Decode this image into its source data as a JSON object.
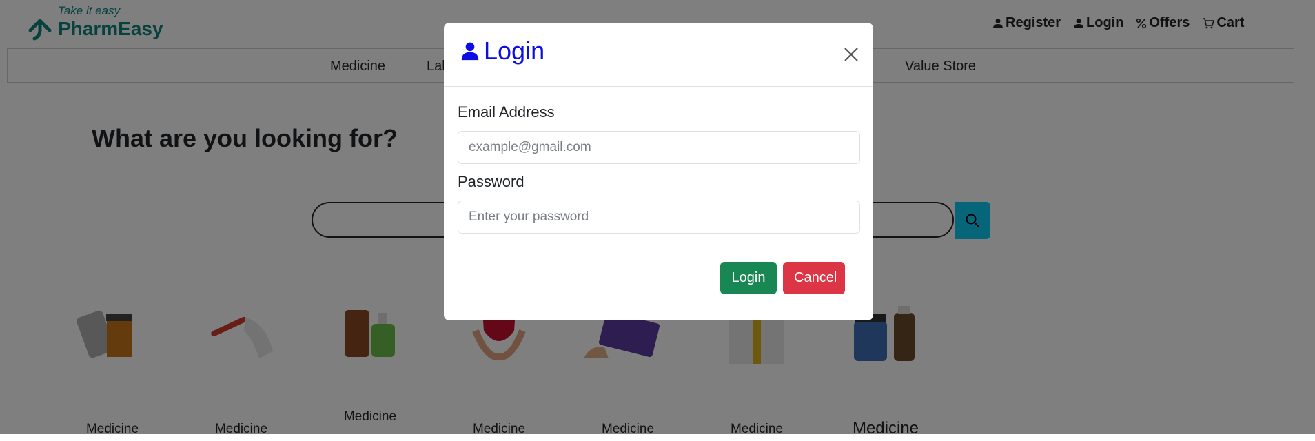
{
  "brand": {
    "tagline": "Take it easy",
    "name": "PharmEasy",
    "color": "#10847e"
  },
  "top_nav": {
    "items": [
      {
        "label": "Register",
        "icon": "user-icon"
      },
      {
        "label": "Login",
        "icon": "user-icon"
      },
      {
        "label": "Offers",
        "icon": "percent-icon"
      },
      {
        "label": "Cart",
        "icon": "cart-icon"
      }
    ]
  },
  "sub_nav": {
    "items": [
      "Medicine",
      "Lab",
      "Value Store"
    ]
  },
  "hero": {
    "title": "What are you looking for?"
  },
  "search": {
    "button_icon": "search-icon",
    "button_color": "#0dcaf0"
  },
  "categories": [
    {
      "label": "Medicine",
      "image": "pills-bottle-image"
    },
    {
      "label": "Medicine",
      "image": "blood-test-tube-image"
    },
    {
      "label": "Medicine",
      "image": "personal-care-products-image"
    },
    {
      "label": "Medicine",
      "image": "heart-in-hands-image"
    },
    {
      "label": "Medicine",
      "image": "plus-card-image"
    },
    {
      "label": "Medicine",
      "image": "gift-box-image"
    },
    {
      "label": "Medicine",
      "image": "liveasy-bottles-image"
    }
  ],
  "modal": {
    "title": "Login",
    "title_color": "#0d0de6",
    "email": {
      "label": "Email Address",
      "placeholder": "example@gmail.com",
      "value": ""
    },
    "password": {
      "label": "Password",
      "placeholder": "Enter your password",
      "value": ""
    },
    "buttons": {
      "login": "Login",
      "cancel": "Cancel",
      "login_color": "#198754",
      "cancel_color": "#dc3545"
    }
  }
}
